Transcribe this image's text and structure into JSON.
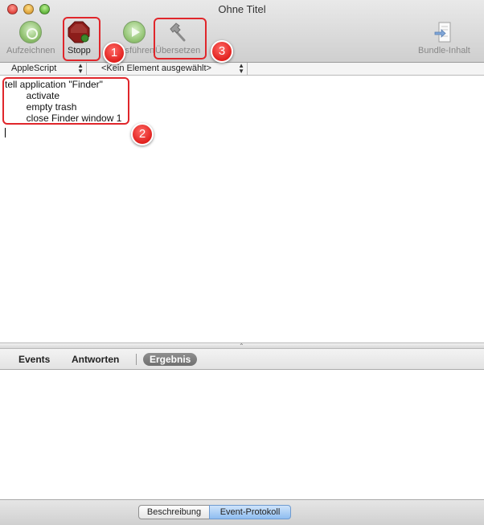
{
  "window": {
    "title": "Ohne Titel"
  },
  "toolbar": {
    "record_label": "Aufzeichnen",
    "stop_label": "Stopp",
    "run_label": "Ausführen",
    "compile_label": "Übersetzen",
    "bundle_label": "Bundle-Inhalt"
  },
  "navigation": {
    "language": "AppleScript",
    "element": "<Kein Element ausgewählt>"
  },
  "editor": {
    "lines": [
      "tell application \"Finder\"",
      "        activate",
      "        empty trash",
      "        close Finder window 1"
    ]
  },
  "result_tabs": {
    "events": "Events",
    "replies": "Antworten",
    "result": "Ergebnis",
    "selected": "Ergebnis"
  },
  "bottom": {
    "description": "Beschreibung",
    "event_log": "Event-Protokoll",
    "selected": "Event-Protokoll"
  },
  "annotations": [
    "1",
    "2",
    "3"
  ],
  "colors": {
    "callout": "#e0262b",
    "selected_segment": "#8fbdf0"
  }
}
